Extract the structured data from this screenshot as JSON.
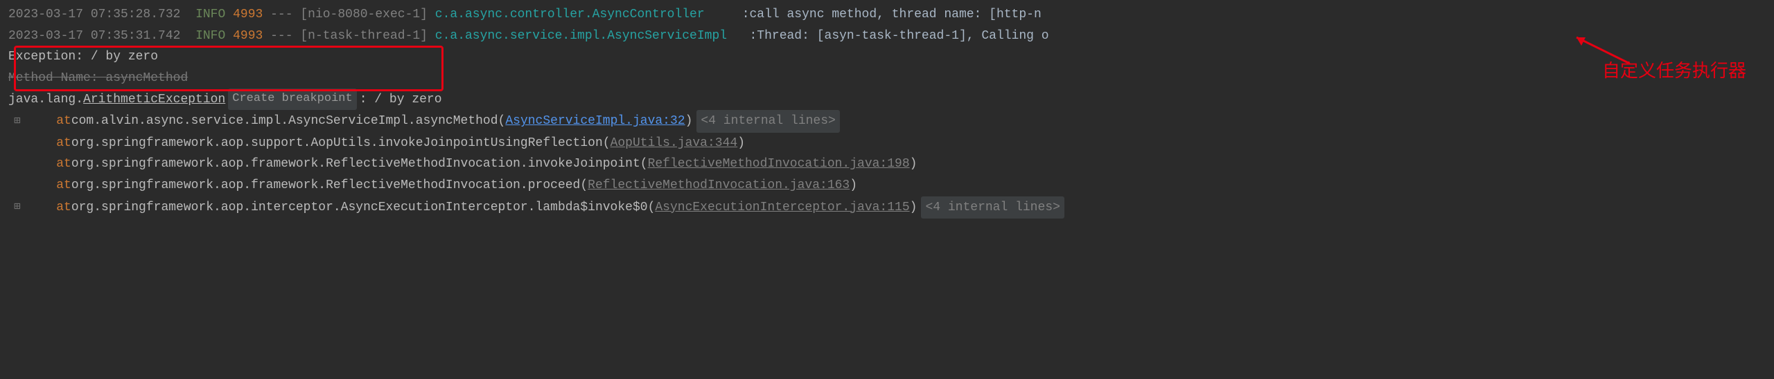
{
  "lines": {
    "l1": {
      "ts": "2023-03-17 07:35:28.732",
      "level": "INFO",
      "pid": "4993",
      "dash": "---",
      "thread": "[nio-8080-exec-1]",
      "logger": "c.a.async.controller.AsyncController",
      "sep": ": ",
      "msg": "call async method, thread name: [http-n"
    },
    "l2": {
      "ts": "2023-03-17 07:35:31.742",
      "level": "INFO",
      "pid": "4993",
      "dash": "---",
      "thread": "[n-task-thread-1]",
      "logger": "c.a.async.service.impl.AsyncServiceImpl",
      "sep": ": ",
      "msg": "Thread: [asyn-task-thread-1], Calling o"
    },
    "l3": {
      "text": "Exception: / by zero"
    },
    "l4": {
      "text": "Method Name: asyncMethod"
    },
    "l5": {
      "cls": "java.lang.",
      "clsLink": "ArithmeticException",
      "bp": "Create breakpoint",
      "rest": ": / by zero"
    },
    "s1": {
      "expand": "⊞",
      "at": "at ",
      "text": "com.alvin.async.service.impl.AsyncServiceImpl.asyncMethod(",
      "link": "AsyncServiceImpl.java:32",
      "close": ")",
      "fold": "<4 internal lines>"
    },
    "s2": {
      "at": "at ",
      "text": "org.springframework.aop.support.AopUtils.invokeJoinpointUsingReflection(",
      "link": "AopUtils.java:344",
      "close": ")"
    },
    "s3": {
      "at": "at ",
      "text": "org.springframework.aop.framework.ReflectiveMethodInvocation.invokeJoinpoint(",
      "link": "ReflectiveMethodInvocation.java:198",
      "close": ")"
    },
    "s4": {
      "at": "at ",
      "text": "org.springframework.aop.framework.ReflectiveMethodInvocation.proceed(",
      "link": "ReflectiveMethodInvocation.java:163",
      "close": ")"
    },
    "s5": {
      "expand": "⊞",
      "at": "at ",
      "text": "org.springframework.aop.interceptor.AsyncExecutionInterceptor.lambda$invoke$0(",
      "link": "AsyncExecutionInterceptor.java:115",
      "close": ")",
      "fold": "<4 internal lines>"
    }
  },
  "annotation": {
    "text": "自定义任务执行器"
  }
}
